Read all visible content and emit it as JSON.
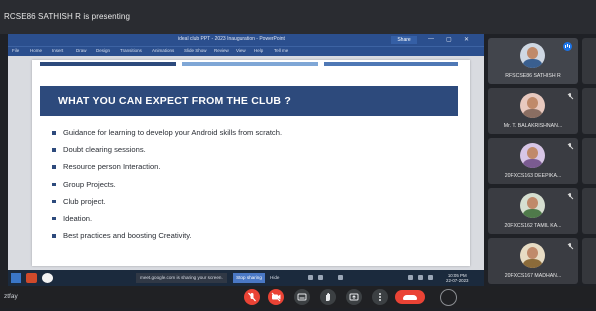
{
  "meet": {
    "presenting_label": "RCSE86 SATHISH R is presenting",
    "meeting_code": "ztfay"
  },
  "powerpoint": {
    "window_title": "ideal club PPT - 2023 Inauguration - PowerPoint",
    "share_label": "Share",
    "window_controls": [
      "—",
      "▢",
      "✕"
    ],
    "ribbon_tabs": [
      "File",
      "Home",
      "Insert",
      "Draw",
      "Design",
      "Transitions",
      "Animations",
      "Slide Show",
      "Review",
      "View",
      "Help",
      "Tell me"
    ]
  },
  "slide": {
    "title": "WHAT YOU CAN EXPECT FROM THE CLUB ?",
    "stripe_colors": [
      "#2d4a7c",
      "#7fa7d6",
      "#4f78b5"
    ],
    "band_color": "#2d4a7c",
    "bullets": [
      "Guidance for learning to develop your Android skills from scratch.",
      "Doubt clearing sessions.",
      "Resource person Interaction.",
      "Group Projects.",
      "Club project.",
      "Ideation.",
      "Best practices and boosting Creativity."
    ]
  },
  "taskbar": {
    "sharing_notice": "meet.google.com is sharing your screen.",
    "stop_sharing_label": "Stop sharing",
    "hide_label": "Hide",
    "clock_time": "10:05 PM",
    "clock_date": "22-07-2023"
  },
  "participants": [
    {
      "name": "RFSCSE86 SATHISH R",
      "avatar_color": "#cfd8e3",
      "shirt_color": "#3a5f8f",
      "state": "speaking"
    },
    {
      "name": "Mr. T. BALAKRISHNAN...",
      "avatar_color": "#e8c9bf",
      "shirt_color": "#8a6e62",
      "state": "muted"
    },
    {
      "name": "20FXCS163 DEEPIKA...",
      "avatar_color": "#d7c6e6",
      "shirt_color": "#7a5b91",
      "state": "muted"
    },
    {
      "name": "20FXCS162 TAMIL KA...",
      "avatar_color": "#d6dfd0",
      "shirt_color": "#4f7a4a",
      "state": "muted"
    },
    {
      "name": "20FXCS167 MADHAN...",
      "avatar_color": "#e7dcc4",
      "shirt_color": "#8b6b3a",
      "state": "muted"
    }
  ],
  "controls": {
    "buttons": [
      "mic-off",
      "camera-off",
      "captions",
      "raise-hand",
      "present",
      "more"
    ]
  }
}
